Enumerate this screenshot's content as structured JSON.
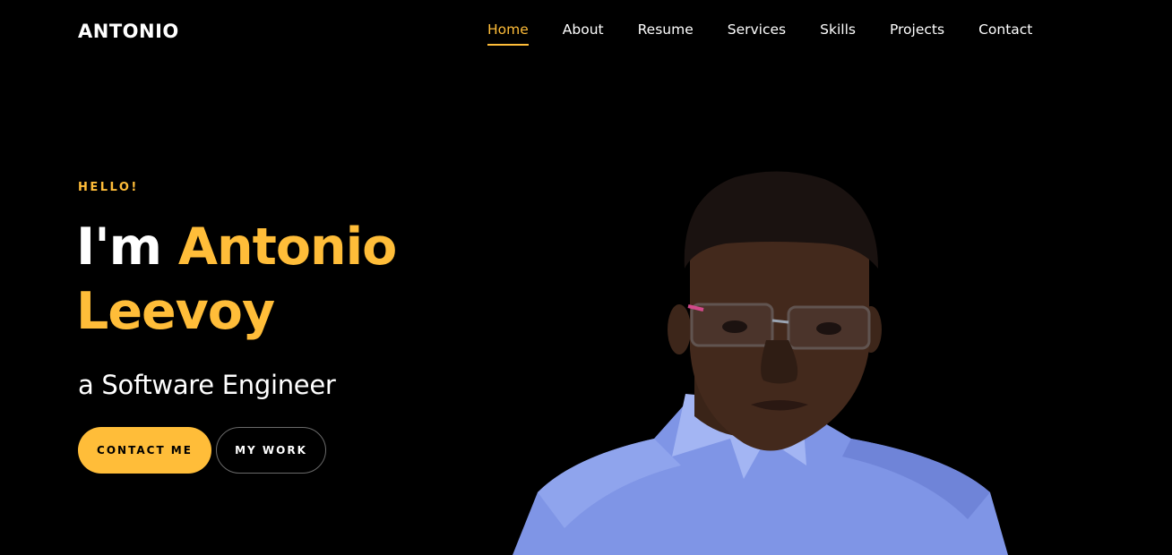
{
  "brand": {
    "logo": "ANTONIO",
    "accent_color": "#ffbd39",
    "background_color": "#000000"
  },
  "nav": {
    "items": [
      {
        "label": "Home",
        "active": true
      },
      {
        "label": "About",
        "active": false
      },
      {
        "label": "Resume",
        "active": false
      },
      {
        "label": "Services",
        "active": false
      },
      {
        "label": "Skills",
        "active": false
      },
      {
        "label": "Projects",
        "active": false
      },
      {
        "label": "Contact",
        "active": false
      }
    ]
  },
  "hero": {
    "greeting": "HELLO!",
    "headline_lead": "I'm",
    "headline_name": "Antonio Leevoy",
    "subtitle": "a Software Engineer",
    "primary_button": "CONTACT ME",
    "secondary_button": "MY WORK",
    "portrait_icon": "person-portrait-icon"
  }
}
